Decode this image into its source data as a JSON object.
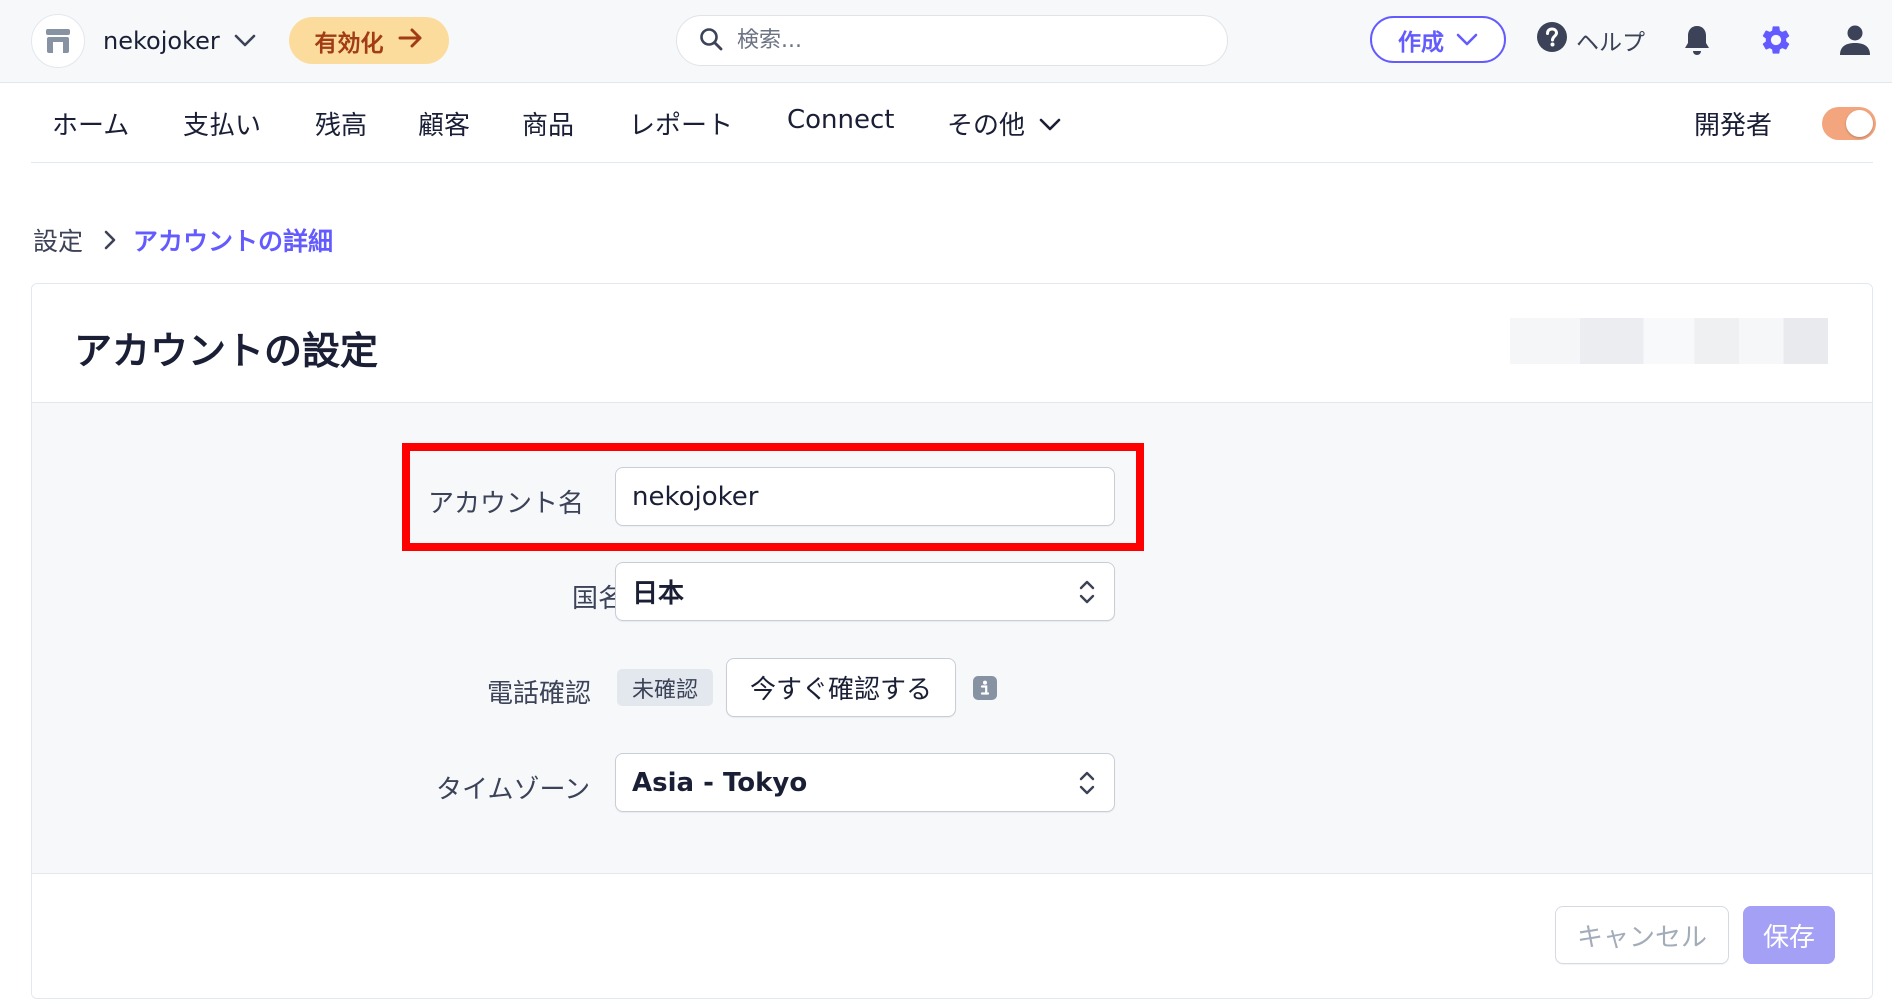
{
  "topbar": {
    "account_name": "nekojoker",
    "account_icon": "store-icon",
    "activate_label": "有効化",
    "search_placeholder": "検索...",
    "create_label": "作成",
    "help_label": "ヘルプ",
    "icons": [
      "bell-icon",
      "gear-icon",
      "user-icon"
    ]
  },
  "nav": {
    "items": [
      "ホーム",
      "支払い",
      "残高",
      "顧客",
      "商品",
      "レポート",
      "Connect",
      "その他"
    ],
    "developer_label": "開発者",
    "developer_mode_on": true
  },
  "breadcrumb": {
    "parent": "設定",
    "current": "アカウントの詳細"
  },
  "card": {
    "title": "アカウントの設定",
    "fields": {
      "account_name_label": "アカウント名",
      "account_name_value": "nekojoker",
      "country_label": "国名",
      "country_value": "日本",
      "phone_label": "電話確認",
      "phone_status": "未確認",
      "phone_verify_button": "今すぐ確認する",
      "timezone_label": "タイムゾーン",
      "timezone_value": "Asia - Tokyo"
    },
    "footer": {
      "cancel_label": "キャンセル",
      "save_label": "保存"
    }
  },
  "colors": {
    "accent": "#635bff",
    "activate_bg": "#fbdc9c",
    "activate_text": "#a13c16",
    "highlight": "#ff0000",
    "toggle_on": "#f3a67e"
  }
}
